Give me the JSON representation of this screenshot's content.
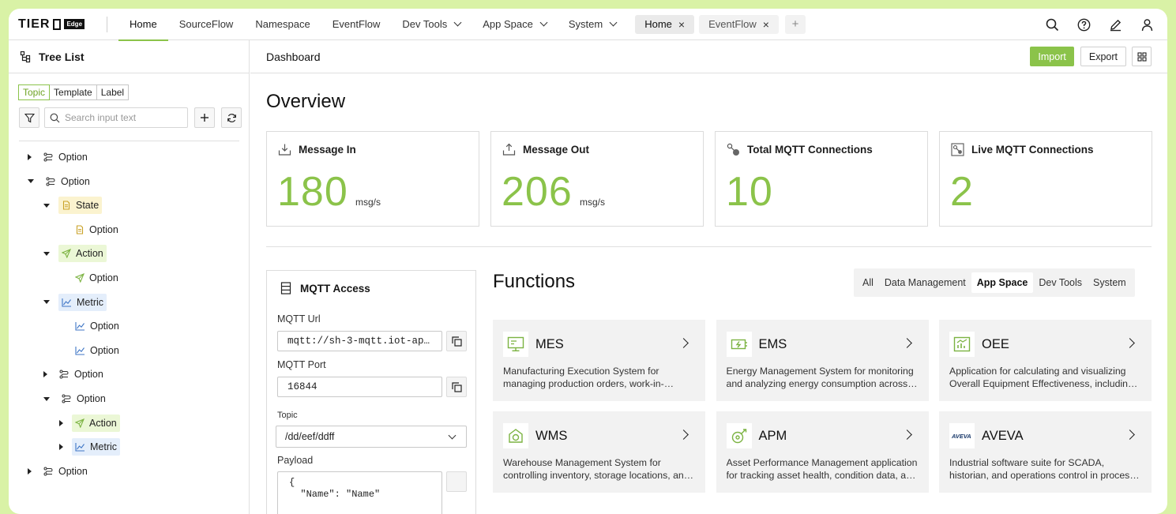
{
  "brand": {
    "name": "TIER",
    "badge": "Edge"
  },
  "nav": {
    "tabs": [
      {
        "label": "Home",
        "active": true,
        "dropdown": false
      },
      {
        "label": "SourceFlow",
        "active": false,
        "dropdown": false
      },
      {
        "label": "Namespace",
        "active": false,
        "dropdown": false
      },
      {
        "label": "EventFlow",
        "active": false,
        "dropdown": false
      },
      {
        "label": "Dev Tools",
        "active": false,
        "dropdown": true
      },
      {
        "label": "App Space",
        "active": false,
        "dropdown": true
      },
      {
        "label": "System",
        "active": false,
        "dropdown": true
      }
    ],
    "open_tabs": [
      {
        "label": "Home",
        "current": true
      },
      {
        "label": "EventFlow",
        "current": false
      }
    ],
    "add_tab": "+",
    "icons": [
      "search-icon",
      "help-icon",
      "edit-icon",
      "user-icon"
    ]
  },
  "sidebar": {
    "title": "Tree List",
    "segments": [
      "Topic",
      "Template",
      "Label"
    ],
    "active_segment": "Topic",
    "search_placeholder": "Search input text",
    "tree": [
      {
        "label": "Option",
        "depth": 0,
        "expanded": false,
        "type": "option"
      },
      {
        "label": "Option",
        "depth": 0,
        "expanded": true,
        "type": "option"
      },
      {
        "label": "State",
        "depth": 1,
        "expanded": true,
        "type": "state"
      },
      {
        "label": "Option",
        "depth": 2,
        "expanded": null,
        "type": "state-leaf"
      },
      {
        "label": "Action",
        "depth": 1,
        "expanded": true,
        "type": "action"
      },
      {
        "label": "Option",
        "depth": 2,
        "expanded": null,
        "type": "action-leaf"
      },
      {
        "label": "Metric",
        "depth": 1,
        "expanded": true,
        "type": "metric"
      },
      {
        "label": "Option",
        "depth": 2,
        "expanded": null,
        "type": "metric-leaf"
      },
      {
        "label": "Option",
        "depth": 2,
        "expanded": null,
        "type": "metric-leaf"
      },
      {
        "label": "Option",
        "depth": 1,
        "expanded": false,
        "type": "option"
      },
      {
        "label": "Option",
        "depth": 1,
        "expanded": true,
        "type": "option"
      },
      {
        "label": "Action",
        "depth": 2,
        "expanded": false,
        "type": "action"
      },
      {
        "label": "Metric",
        "depth": 2,
        "expanded": false,
        "type": "metric"
      },
      {
        "label": "Option",
        "depth": 0,
        "expanded": false,
        "type": "option"
      }
    ]
  },
  "main": {
    "page_title": "Dashboard",
    "import_label": "Import",
    "export_label": "Export",
    "overview_title": "Overview",
    "stats": [
      {
        "title": "Message In",
        "value": "180",
        "unit": "msg/s",
        "icon": "download-icon"
      },
      {
        "title": "Message Out",
        "value": "206",
        "unit": "msg/s",
        "icon": "upload-icon"
      },
      {
        "title": "Total MQTT Connections",
        "value": "10",
        "unit": "",
        "icon": "connection-icon"
      },
      {
        "title": "Live MQTT Connections",
        "value": "2",
        "unit": "",
        "icon": "live-connection-icon"
      }
    ],
    "mqtt": {
      "title": "MQTT Access",
      "url_label": "MQTT Url",
      "url_value": "mqtt://sh-3-mqtt.iot-ap…",
      "port_label": "MQTT Port",
      "port_value": "16844",
      "topic_label": "Topic",
      "topic_value": "/dd/eef/ddff",
      "payload_label": "Payload",
      "payload_value": "{\n  \"Name\": \"Name\""
    },
    "functions": {
      "title": "Functions",
      "filters": [
        "All",
        "Data Management",
        "App Space",
        "Dev Tools",
        "System"
      ],
      "active_filter": "App Space",
      "cards": [
        {
          "name": "MES",
          "icon": "monitor-icon",
          "desc": "Manufacturing Execution System for managing production orders, work-in-process tracking, and quality."
        },
        {
          "name": "EMS",
          "icon": "energy-icon",
          "desc": "Energy Management System for monitoring and analyzing energy consumption across the plant."
        },
        {
          "name": "OEE",
          "icon": "chart-icon",
          "desc": "Application for calculating and visualizing Overall Equipment Effectiveness, including availability."
        },
        {
          "name": "WMS",
          "icon": "warehouse-icon",
          "desc": "Warehouse Management System for controlling inventory, storage locations, and logistics."
        },
        {
          "name": "APM",
          "icon": "gauge-icon",
          "desc": "Asset Performance Management application for tracking asset health, condition data, and maintenance."
        },
        {
          "name": "AVEVA",
          "icon": "aveva-logo-icon",
          "desc": "Industrial software suite for SCADA, historian, and operations control in process industries."
        }
      ]
    }
  },
  "colors": {
    "accent": "#8bc34a",
    "frame": "#d9f2a6",
    "state_bg": "#fbf3cf",
    "action_bg": "#ebf7d6",
    "metric_bg": "#e4eefb"
  }
}
